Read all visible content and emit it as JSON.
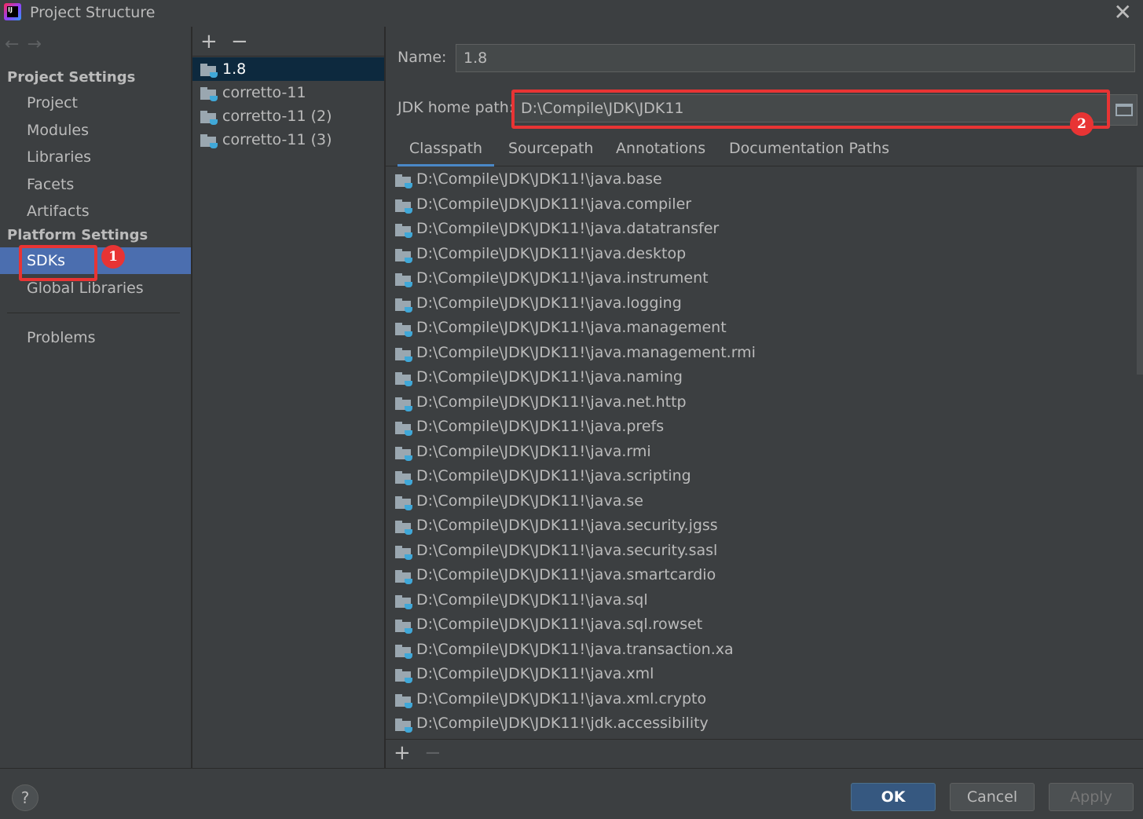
{
  "window": {
    "title": "Project Structure"
  },
  "nav": {
    "project_settings_heading": "Project Settings",
    "project_items": [
      "Project",
      "Modules",
      "Libraries",
      "Facets",
      "Artifacts"
    ],
    "platform_settings_heading": "Platform Settings",
    "platform_items": [
      "SDKs",
      "Global Libraries"
    ],
    "selected": "SDKs",
    "problems": "Problems"
  },
  "sdk_list": {
    "items": [
      "1.8",
      "corretto-11",
      "corretto-11 (2)",
      "corretto-11 (3)"
    ],
    "selected": "1.8"
  },
  "detail": {
    "name_label": "Name:",
    "name_value": "1.8",
    "jdk_home_label": "JDK home path:",
    "jdk_home_value": "D:\\Compile\\JDK\\JDK11",
    "tabs": [
      "Classpath",
      "Sourcepath",
      "Annotations",
      "Documentation Paths"
    ],
    "active_tab": "Classpath",
    "classpath": [
      "D:\\Compile\\JDK\\JDK11!\\java.base",
      "D:\\Compile\\JDK\\JDK11!\\java.compiler",
      "D:\\Compile\\JDK\\JDK11!\\java.datatransfer",
      "D:\\Compile\\JDK\\JDK11!\\java.desktop",
      "D:\\Compile\\JDK\\JDK11!\\java.instrument",
      "D:\\Compile\\JDK\\JDK11!\\java.logging",
      "D:\\Compile\\JDK\\JDK11!\\java.management",
      "D:\\Compile\\JDK\\JDK11!\\java.management.rmi",
      "D:\\Compile\\JDK\\JDK11!\\java.naming",
      "D:\\Compile\\JDK\\JDK11!\\java.net.http",
      "D:\\Compile\\JDK\\JDK11!\\java.prefs",
      "D:\\Compile\\JDK\\JDK11!\\java.rmi",
      "D:\\Compile\\JDK\\JDK11!\\java.scripting",
      "D:\\Compile\\JDK\\JDK11!\\java.se",
      "D:\\Compile\\JDK\\JDK11!\\java.security.jgss",
      "D:\\Compile\\JDK\\JDK11!\\java.security.sasl",
      "D:\\Compile\\JDK\\JDK11!\\java.smartcardio",
      "D:\\Compile\\JDK\\JDK11!\\java.sql",
      "D:\\Compile\\JDK\\JDK11!\\java.sql.rowset",
      "D:\\Compile\\JDK\\JDK11!\\java.transaction.xa",
      "D:\\Compile\\JDK\\JDK11!\\java.xml",
      "D:\\Compile\\JDK\\JDK11!\\java.xml.crypto",
      "D:\\Compile\\JDK\\JDK11!\\jdk.accessibility"
    ]
  },
  "toolbar": {
    "add": "+",
    "remove": "−"
  },
  "footer": {
    "help": "?",
    "ok": "OK",
    "cancel": "Cancel",
    "apply": "Apply"
  },
  "annotations": {
    "badge1": "1",
    "badge2": "2"
  },
  "colors": {
    "selection": "#4b6eaf",
    "accent": "#4a88c7",
    "annotation": "#e83434"
  },
  "icons": {
    "back": "arrow-left-icon",
    "forward": "arrow-right-icon",
    "close": "close-icon",
    "folder": "sdk-folder-icon",
    "browse": "browse-folder-icon",
    "help": "help-icon"
  }
}
